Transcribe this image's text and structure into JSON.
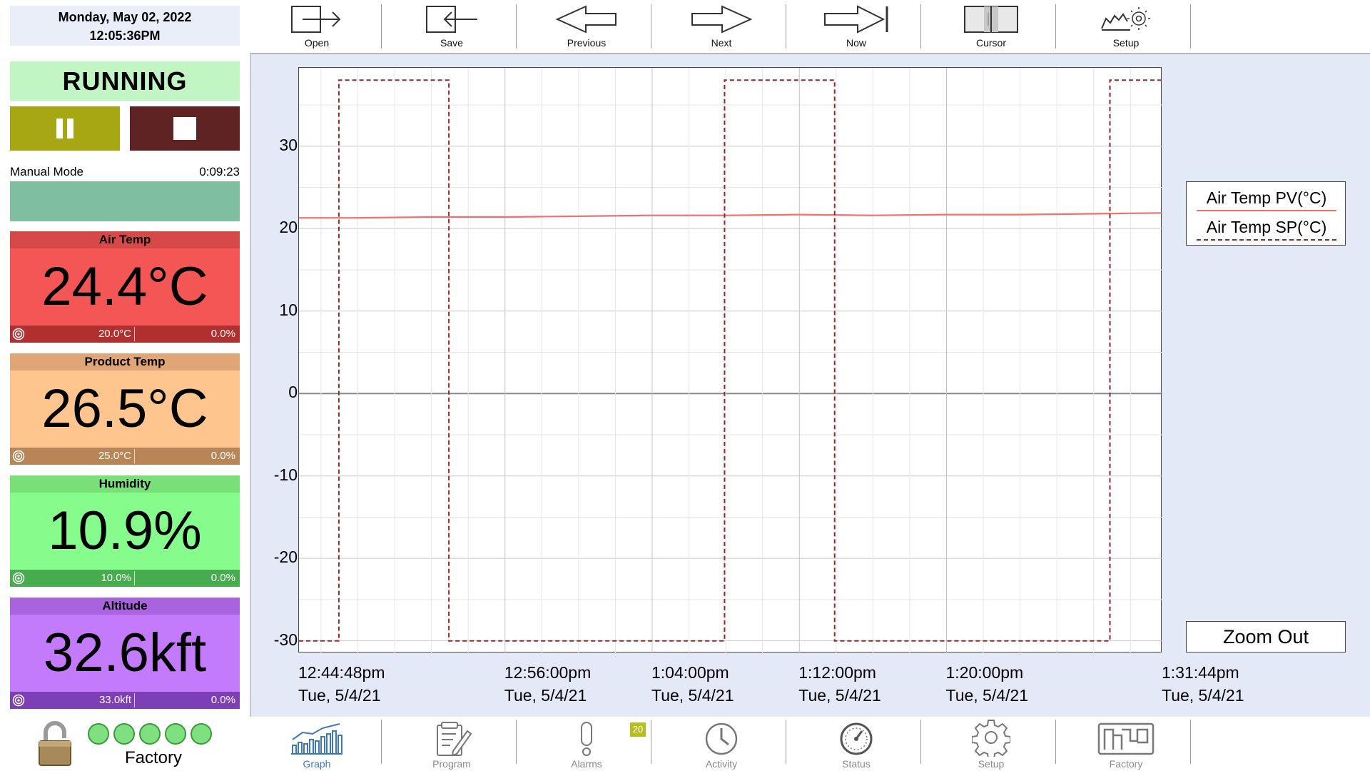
{
  "header": {
    "date": "Monday, May 02, 2022",
    "time": "12:05:36PM"
  },
  "status": {
    "state": "RUNNING",
    "mode_label": "Manual Mode",
    "mode_time": "0:09:23"
  },
  "cards": [
    {
      "title": "Air Temp",
      "value": "24.4°C",
      "setpoint": "20.0°C",
      "output": "0.0%",
      "head_color": "#d74848",
      "body_color": "#f45656",
      "foot_color": "#b22f2f"
    },
    {
      "title": "Product Temp",
      "value": "26.5°C",
      "setpoint": "25.0°C",
      "output": "0.0%",
      "head_color": "#e0a677",
      "body_color": "#fec58e",
      "foot_color": "#b88556"
    },
    {
      "title": "Humidity",
      "value": "10.9%",
      "setpoint": "10.0%",
      "output": "0.0%",
      "head_color": "#79e079",
      "body_color": "#86fc8c",
      "foot_color": "#47ac4d"
    },
    {
      "title": "Altitude",
      "value": "32.6kft",
      "setpoint": "33.0kft",
      "output": "0.0%",
      "head_color": "#a963df",
      "body_color": "#c47bfb",
      "foot_color": "#7d3fb5"
    }
  ],
  "footer_left": {
    "label": "Factory",
    "indicator_count": 5
  },
  "toolbar": [
    {
      "label": "Open",
      "icon": "open-arrow-icon"
    },
    {
      "label": "Save",
      "icon": "save-arrow-icon"
    },
    {
      "label": "Previous",
      "icon": "previous-arrow-icon"
    },
    {
      "label": "Next",
      "icon": "next-arrow-icon"
    },
    {
      "label": "Now",
      "icon": "now-arrow-icon"
    },
    {
      "label": "Cursor",
      "icon": "cursor-icon"
    },
    {
      "label": "Setup",
      "icon": "graph-setup-icon"
    }
  ],
  "nav": [
    {
      "label": "Graph",
      "icon": "graph-icon",
      "active": true
    },
    {
      "label": "Program",
      "icon": "program-icon",
      "active": false
    },
    {
      "label": "Alarms",
      "icon": "alarm-icon",
      "active": false,
      "badge": "20"
    },
    {
      "label": "Activity",
      "icon": "clock-icon",
      "active": false
    },
    {
      "label": "Status",
      "icon": "gauge-icon",
      "active": false
    },
    {
      "label": "Setup",
      "icon": "gear-icon",
      "active": false
    },
    {
      "label": "Factory",
      "icon": "factory-logo-icon",
      "active": false
    }
  ],
  "legend": [
    {
      "label": "Air Temp PV(°C)",
      "color": "#f07070"
    },
    {
      "label": "Air Temp SP(°C)",
      "color": "#8b2b2b"
    }
  ],
  "zoom_label": "Zoom Out",
  "chart_data": {
    "type": "line",
    "ylim": [
      -31.5,
      39.5
    ],
    "y_ticks": [
      30,
      20,
      10,
      0,
      -10,
      -20,
      -30
    ],
    "x_ticks": [
      {
        "time": "12:44:48pm",
        "date": "Tue, 5/4/21"
      },
      {
        "time": "12:56:00pm",
        "date": "Tue, 5/4/21"
      },
      {
        "time": "1:04:00pm",
        "date": "Tue, 5/4/21"
      },
      {
        "time": "1:12:00pm",
        "date": "Tue, 5/4/21"
      },
      {
        "time": "1:20:00pm",
        "date": "Tue, 5/4/21"
      },
      {
        "time": "1:31:44pm",
        "date": "Tue, 5/4/21"
      }
    ],
    "series": [
      {
        "name": "Air Temp PV(°C)",
        "style": "solid",
        "color": "#f07070",
        "x": [
          "12:44:48pm",
          "12:48:00pm",
          "12:52:00pm",
          "12:56:00pm",
          "1:00:00pm",
          "1:04:00pm",
          "1:08:00pm",
          "1:12:00pm",
          "1:16:00pm",
          "1:20:00pm",
          "1:24:00pm",
          "1:28:00pm",
          "1:31:44pm"
        ],
        "values": [
          21.3,
          21.3,
          21.4,
          21.4,
          21.5,
          21.6,
          21.6,
          21.7,
          21.6,
          21.7,
          21.7,
          21.8,
          21.9
        ]
      },
      {
        "name": "Air Temp SP(°C)",
        "style": "dashed",
        "color": "#8b2b2b",
        "x": [
          "12:44:48pm",
          "12:46:58pm",
          "12:46:58pm",
          "12:52:57pm",
          "12:52:57pm",
          "1:07:56pm",
          "1:07:56pm",
          "1:13:55pm",
          "1:13:55pm",
          "1:28:53pm",
          "1:28:53pm",
          "1:31:44pm"
        ],
        "values": [
          -30,
          -30,
          38,
          38,
          -30,
          -30,
          38,
          38,
          -30,
          -30,
          38,
          38
        ]
      }
    ]
  }
}
